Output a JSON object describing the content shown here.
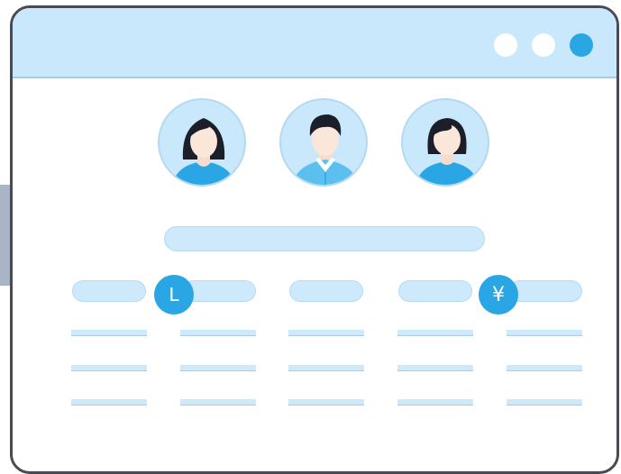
{
  "window": {
    "controls": [
      {
        "name": "window-dot-1",
        "color": "#ffffff"
      },
      {
        "name": "window-dot-2",
        "color": "#ffffff"
      },
      {
        "name": "window-dot-3",
        "color": "#2ba6e4"
      }
    ]
  },
  "avatars": [
    {
      "name": "avatar-woman-1",
      "hair": "long-dark",
      "shirt": "#2ba6e4"
    },
    {
      "name": "avatar-man",
      "hair": "short-dark",
      "shirt": "#5cc0ee"
    },
    {
      "name": "avatar-woman-2",
      "hair": "bob-dark",
      "shirt": "#2ba6e4"
    }
  ],
  "icons": {
    "clock": {
      "name": "clock-icon",
      "glyph": "L"
    },
    "yen": {
      "name": "yen-icon",
      "glyph": "¥"
    }
  },
  "colors": {
    "accent": "#2ba6e4",
    "light": "#c9e8fb",
    "border": "#4a4a55"
  }
}
